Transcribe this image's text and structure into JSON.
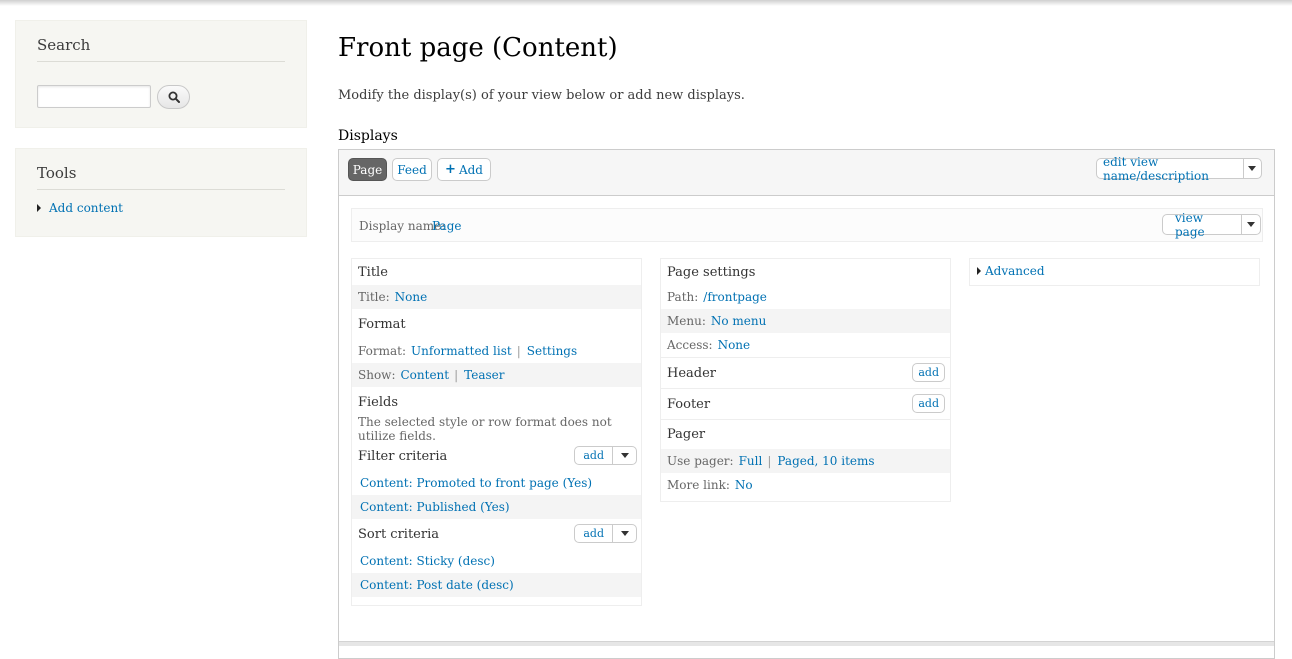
{
  "sidebar": {
    "search": {
      "title": "Search",
      "input_value": ""
    },
    "tools": {
      "title": "Tools",
      "items": [
        {
          "label": "Add content"
        }
      ]
    }
  },
  "main": {
    "title": "Front page (Content)",
    "description": "Modify the display(s) of your view below or add new displays.",
    "displays_label": "Displays",
    "tabs": {
      "page": "Page",
      "feed": "Feed",
      "add": "Add"
    },
    "edit_view": "edit view name/description",
    "display_name": {
      "label": "Display name:",
      "value": "Page",
      "view_page": "view page"
    },
    "column1": {
      "title": {
        "heading": "Title",
        "key": "Title:",
        "value": "None"
      },
      "format": {
        "heading": "Format",
        "format_key": "Format:",
        "format_value": "Unformatted list",
        "settings": "Settings",
        "show_key": "Show:",
        "show_value": "Content",
        "show_value2": "Teaser"
      },
      "fields": {
        "heading": "Fields",
        "note": "The selected style or row format does not utilize fields."
      },
      "filter": {
        "heading": "Filter criteria",
        "add": "add",
        "items": [
          "Content: Promoted to front page (Yes)",
          "Content: Published (Yes)"
        ]
      },
      "sort": {
        "heading": "Sort criteria",
        "add": "add",
        "items": [
          "Content: Sticky (desc)",
          "Content: Post date (desc)"
        ]
      }
    },
    "column2": {
      "page_settings": {
        "heading": "Page settings",
        "path_key": "Path:",
        "path_value": "/frontpage",
        "menu_key": "Menu:",
        "menu_value": "No menu",
        "access_key": "Access:",
        "access_value": "None"
      },
      "header": {
        "heading": "Header",
        "add": "add"
      },
      "footer": {
        "heading": "Footer",
        "add": "add"
      },
      "pager": {
        "heading": "Pager",
        "use_key": "Use pager:",
        "use_value": "Full",
        "use_value2": "Paged, 10 items",
        "more_key": "More link:",
        "more_value": "No"
      }
    },
    "column3": {
      "advanced": "Advanced"
    }
  },
  "colors": {
    "link": "#0071b3",
    "active_tab": "#666666",
    "sidebar_bg": "#f6f6f2"
  }
}
